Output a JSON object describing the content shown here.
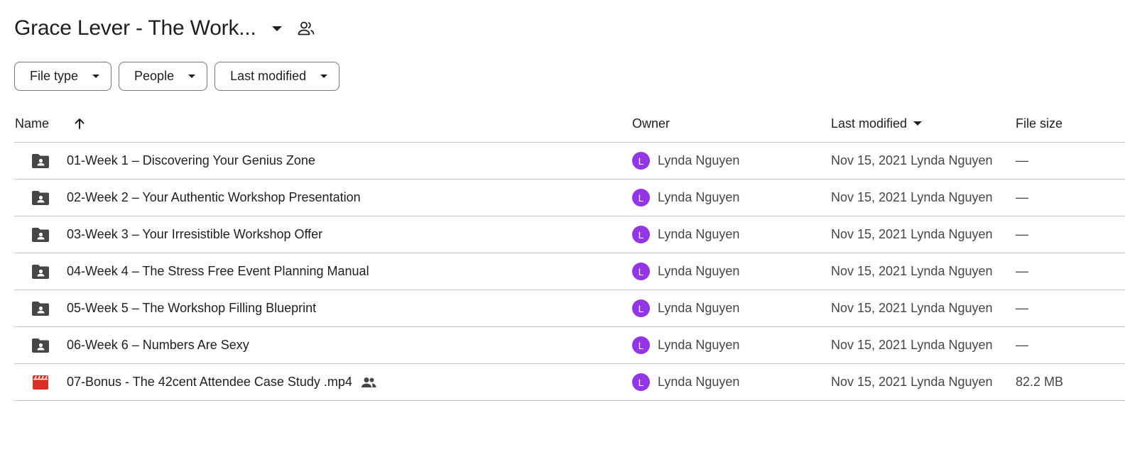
{
  "header": {
    "title": "Grace Lever - The Work..."
  },
  "filters": [
    {
      "label": "File type"
    },
    {
      "label": "People"
    },
    {
      "label": "Last modified"
    }
  ],
  "columns": {
    "name": "Name",
    "owner": "Owner",
    "last_modified": "Last modified",
    "file_size": "File size"
  },
  "rows": [
    {
      "name": "01-Week 1 – Discovering Your Genius Zone",
      "icon": "shared-folder-icon",
      "owner_initial": "L",
      "owner": "Lynda Nguyen",
      "modified_date": "Nov 15, 2021",
      "modified_by": "Lynda Nguyen",
      "size": "—"
    },
    {
      "name": "02-Week 2 – Your Authentic Workshop Presentation",
      "icon": "shared-folder-icon",
      "owner_initial": "L",
      "owner": "Lynda Nguyen",
      "modified_date": "Nov 15, 2021",
      "modified_by": "Lynda Nguyen",
      "size": "—"
    },
    {
      "name": "03-Week 3 – Your Irresistible Workshop Offer",
      "icon": "shared-folder-icon",
      "owner_initial": "L",
      "owner": "Lynda Nguyen",
      "modified_date": "Nov 15, 2021",
      "modified_by": "Lynda Nguyen",
      "size": "—"
    },
    {
      "name": "04-Week 4 – The Stress Free Event Planning Manual",
      "icon": "shared-folder-icon",
      "owner_initial": "L",
      "owner": "Lynda Nguyen",
      "modified_date": "Nov 15, 2021",
      "modified_by": "Lynda Nguyen",
      "size": "—"
    },
    {
      "name": "05-Week 5 – The Workshop Filling Blueprint",
      "icon": "shared-folder-icon",
      "owner_initial": "L",
      "owner": "Lynda Nguyen",
      "modified_date": "Nov 15, 2021",
      "modified_by": "Lynda Nguyen",
      "size": "—"
    },
    {
      "name": "06-Week 6 – Numbers Are Sexy",
      "icon": "shared-folder-icon",
      "owner_initial": "L",
      "owner": "Lynda Nguyen",
      "modified_date": "Nov 15, 2021",
      "modified_by": "Lynda Nguyen",
      "size": "—"
    },
    {
      "name": "07-Bonus - The 42cent Attendee Case Study .mp4",
      "icon": "video-file-icon",
      "owner_initial": "L",
      "owner": "Lynda Nguyen",
      "modified_date": "Nov 15, 2021",
      "modified_by": "Lynda Nguyen",
      "size": "82.2 MB"
    }
  ],
  "colors": {
    "avatar": "#9334e6",
    "folder_icon": "#444746",
    "video_icon": "#d93025",
    "divider": "#c4c7c5"
  }
}
